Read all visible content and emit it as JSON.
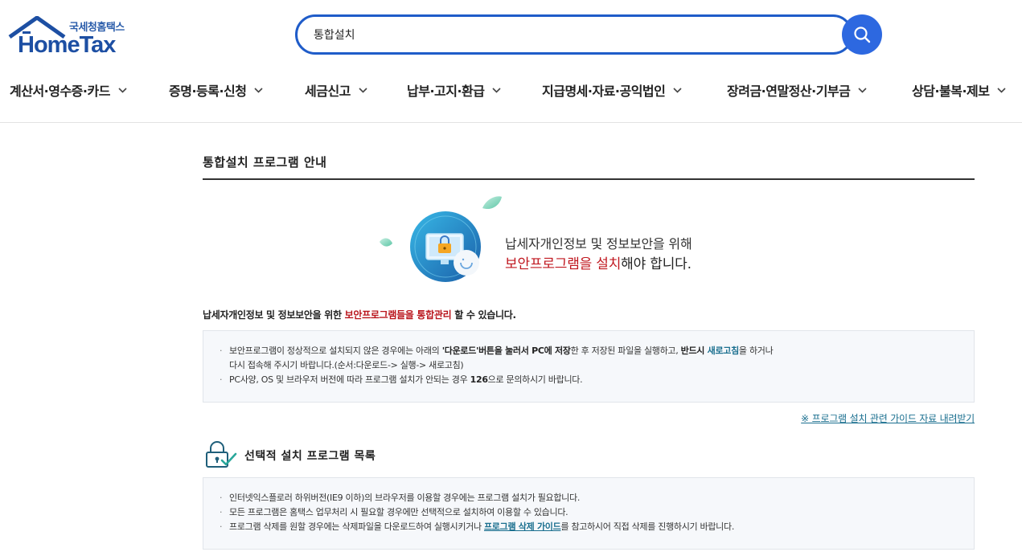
{
  "header": {
    "logo_kr": "국세청홈택스",
    "logo_en": "HomeTax",
    "search": {
      "value": "통합설치"
    }
  },
  "nav": [
    {
      "label": "계산서·영수증·카드"
    },
    {
      "label": "증명·등록·신청"
    },
    {
      "label": "세금신고"
    },
    {
      "label": "납부·고지·환급"
    },
    {
      "label": "지급명세·자료·공익법인"
    },
    {
      "label": "장려금·연말정산·기부금"
    },
    {
      "label": "상담·불복·제보"
    }
  ],
  "main": {
    "title": "통합설치 프로그램 안내",
    "hero": {
      "line1": "납세자개인정보 및 정보보안을 위해",
      "line2_red": "보안프로그램을 설치",
      "line2_rest": "해야 합니다."
    },
    "lead": {
      "pre": "납세자개인정보 및 정보보안을 위한 ",
      "red": "보안프로그램들을 통합관리",
      "post": " 할 수 있습니다."
    },
    "notice1": {
      "l1_a": "보안프로그램이 정상적으로 설치되지 않은 경우에는 아래의 ",
      "l1_b": "'다운로드'버튼을 눌러서 PC에 저장",
      "l1_c": "한 후 저장된 파일을 실행하고, ",
      "l1_d": "반드시 ",
      "l1_e": "새로고침",
      "l1_f": "을 하거나",
      "l2": "다시 접속해 주시기 바랍니다.(순서:다운로드-> 실행-> 새로고침)",
      "l3_a": "PC사양, OS 및 브라우저 버전에 따라 프로그램 설치가 안되는 경우 ",
      "l3_b": "126",
      "l3_c": "으로 문의하시기 바랍니다."
    },
    "guide_link": "※ 프로그램 설치 관련 가이드 자료 내려받기",
    "section_title": "선택적 설치 프로그램 목록",
    "notice2": {
      "l1": "인터넷익스플로러 하위버전(IE9 이하)의 브라우저를 이용할 경우에는 프로그램 설치가 필요합니다.",
      "l2": "모든 프로그램은 홈택스 업무처리 시 필요할 경우에만 선택적으로 설치하여 이용할 수 있습니다.",
      "l3_a": "프로그램 삭제를 원할 경우에는 삭제파일을 다운로드하여 실행시키거나 ",
      "l3_link": "프로그램 삭제 가이드",
      "l3_c": "를 참고하시어 직접 삭제를 진행하시기 바랍니다."
    }
  },
  "colors": {
    "brand_blue": "#1d4fa3",
    "search_border": "#1f5cc9",
    "search_button": "#2d68e0",
    "emphasis_red": "#c0171f",
    "link_teal": "#1a6f8f"
  },
  "icons": {
    "logo": "house-roof-logo",
    "search_button": "magnifier-icon",
    "nav_chevron": "chevron-down-icon",
    "hero": "monitor-lock-illustration",
    "section": "lock-check-icon"
  }
}
